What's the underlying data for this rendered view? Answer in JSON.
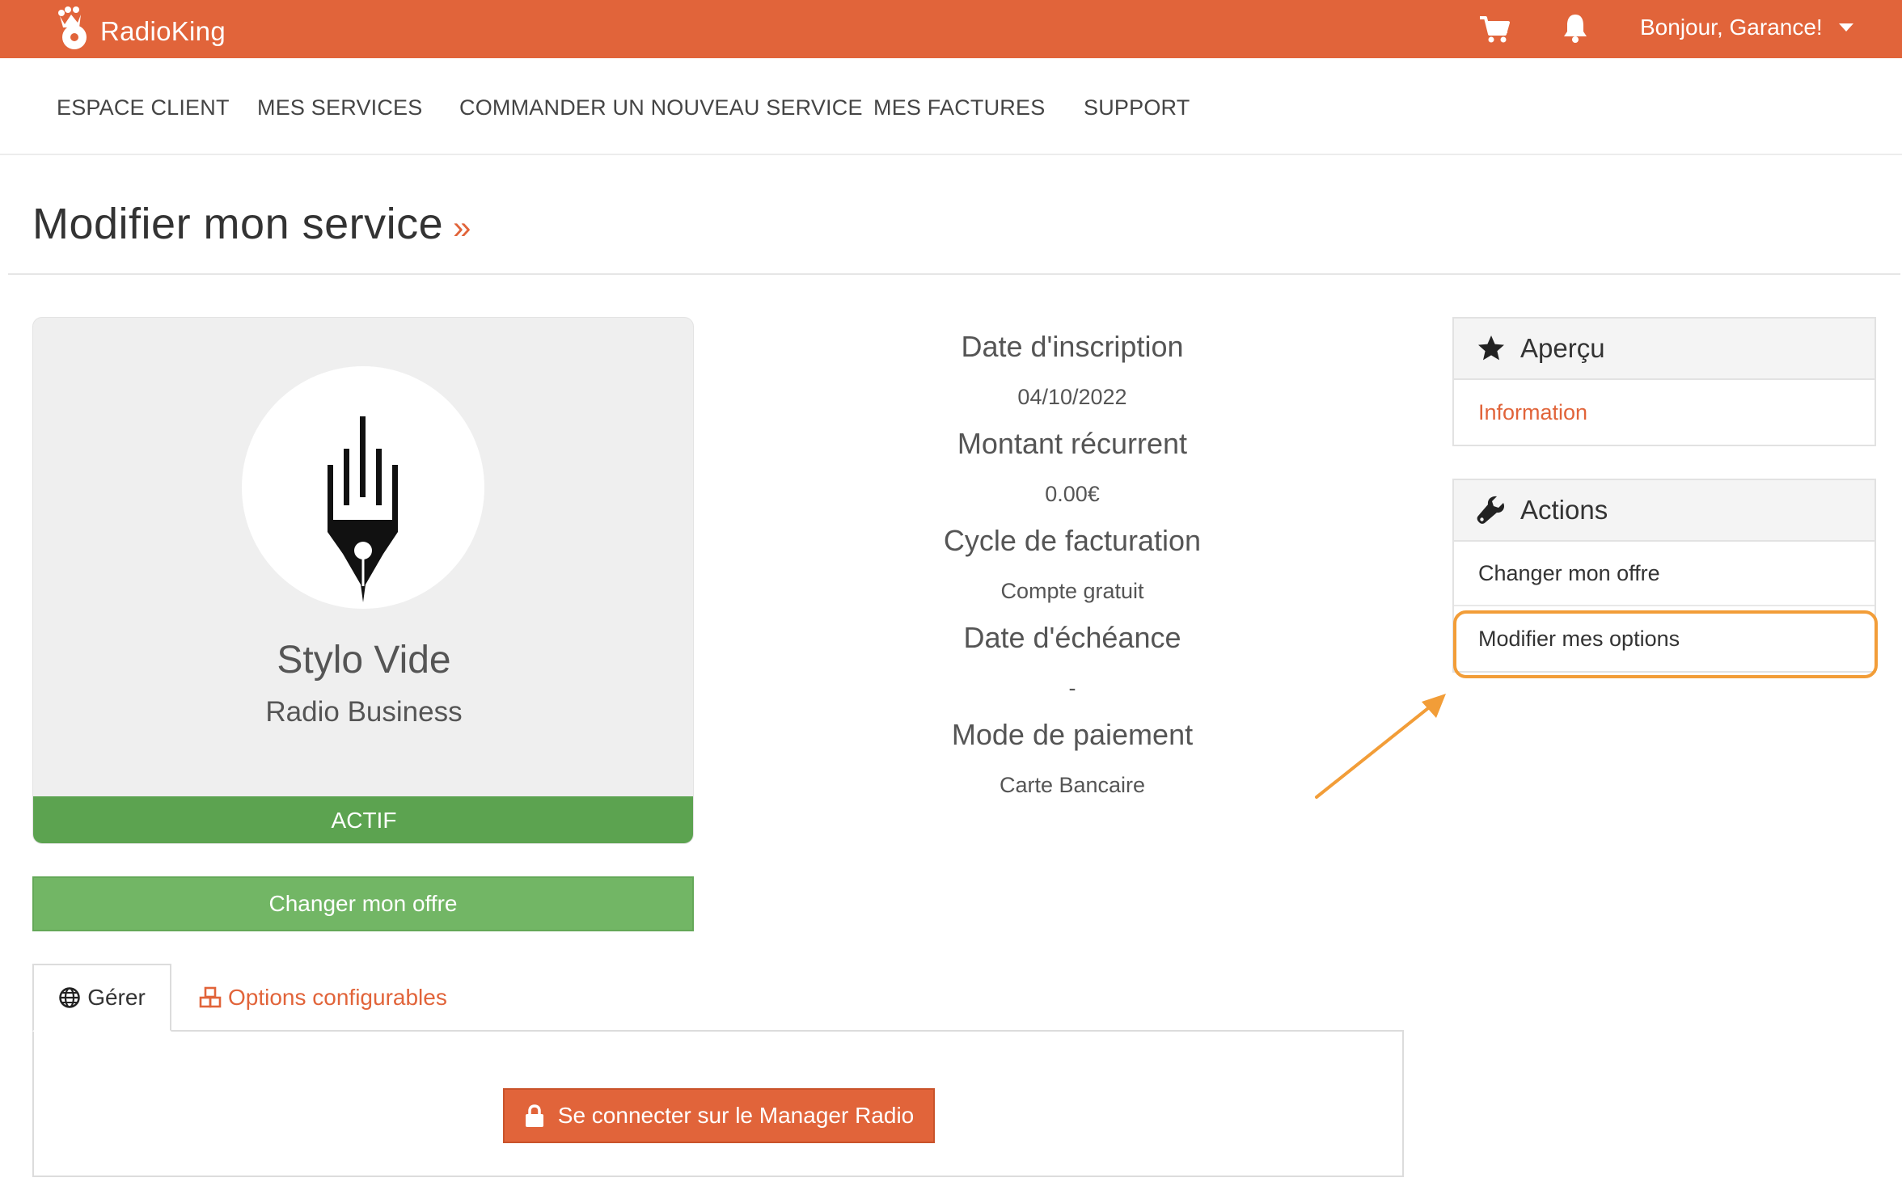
{
  "header": {
    "brand": "RadioKing",
    "greeting": "Bonjour, Garance!",
    "accent_color": "#e1643a"
  },
  "nav": {
    "items": [
      {
        "label": "ESPACE CLIENT"
      },
      {
        "label": "MES SERVICES"
      },
      {
        "label": "COMMANDER UN NOUVEAU SERVICE"
      },
      {
        "label": "MES FACTURES"
      },
      {
        "label": "SUPPORT"
      }
    ]
  },
  "page": {
    "title": "Modifier mon service",
    "title_suffix": "»"
  },
  "service": {
    "name": "Stylo Vide",
    "type": "Radio Business",
    "status": "ACTIF",
    "status_color": "#5ca350",
    "change_offer_label": "Changer mon offre"
  },
  "details": [
    {
      "label": "Date d'inscription",
      "value": "04/10/2022"
    },
    {
      "label": "Montant récurrent",
      "value": "0.00€"
    },
    {
      "label": "Cycle de facturation",
      "value": "Compte gratuit"
    },
    {
      "label": "Date d'échéance",
      "value": "-"
    },
    {
      "label": "Mode de paiement",
      "value": "Carte Bancaire"
    }
  ],
  "sidebar": {
    "overview": {
      "title": "Aperçu",
      "icon": "star-icon",
      "items": [
        {
          "label": "Information"
        }
      ]
    },
    "actions": {
      "title": "Actions",
      "icon": "wrench-icon",
      "items": [
        {
          "label": "Changer mon offre"
        },
        {
          "label": "Modifier mes options"
        }
      ]
    },
    "highlight_color": "#f29d38"
  },
  "tabs": {
    "items": [
      {
        "label": "Gérer",
        "icon": "globe-icon"
      },
      {
        "label": "Options configurables",
        "icon": "cubes-icon"
      }
    ],
    "connect_label": "Se connecter sur le Manager Radio"
  }
}
